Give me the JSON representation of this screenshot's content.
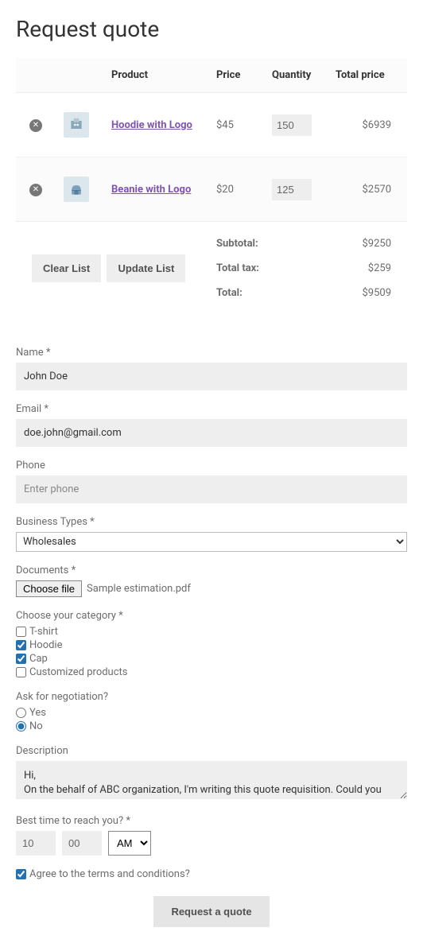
{
  "page_title": "Request quote",
  "table": {
    "headers": {
      "product": "Product",
      "price": "Price",
      "quantity": "Quantity",
      "total": "Total price"
    },
    "rows": [
      {
        "name": "Hoodie with Logo",
        "price": "$45",
        "qty": "150",
        "total": "$6939"
      },
      {
        "name": "Beanie with Logo",
        "price": "$20",
        "qty": "125",
        "total": "$2570"
      }
    ],
    "buttons": {
      "clear": "Clear List",
      "update": "Update List"
    },
    "totals": {
      "subtotal_label": "Subtotal:",
      "subtotal_value": "$9250",
      "tax_label": "Total tax:",
      "tax_value": "$259",
      "total_label": "Total:",
      "total_value": "$9509"
    }
  },
  "form": {
    "name": {
      "label": "Name *",
      "value": "John Doe"
    },
    "email": {
      "label": "Email *",
      "value": "doe.john@gmail.com"
    },
    "phone": {
      "label": "Phone",
      "placeholder": "Enter phone"
    },
    "business": {
      "label": "Business Types *",
      "value": "Wholesales"
    },
    "documents": {
      "label": "Documents *",
      "button": "Choose file",
      "filename": "Sample estimation.pdf"
    },
    "category": {
      "label": "Choose your category *",
      "options": [
        {
          "label": "T-shirt",
          "checked": false
        },
        {
          "label": "Hoodie",
          "checked": true
        },
        {
          "label": "Cap",
          "checked": true
        },
        {
          "label": "Customized products",
          "checked": false
        }
      ]
    },
    "negotiation": {
      "label": "Ask for negotiation?",
      "options": [
        {
          "label": "Yes",
          "checked": false
        },
        {
          "label": "No",
          "checked": true
        }
      ]
    },
    "description": {
      "label": "Description",
      "value": "Hi,\nOn the behalf of ABC organization, I'm writing this quote requisition. Could you please have a look at the sample"
    },
    "best_time": {
      "label": "Best time to reach you? *",
      "hour": "10",
      "minute": "00",
      "period": "AM"
    },
    "terms": {
      "label": "Agree to the terms and conditions?",
      "checked": true
    },
    "submit": "Request a quote"
  }
}
